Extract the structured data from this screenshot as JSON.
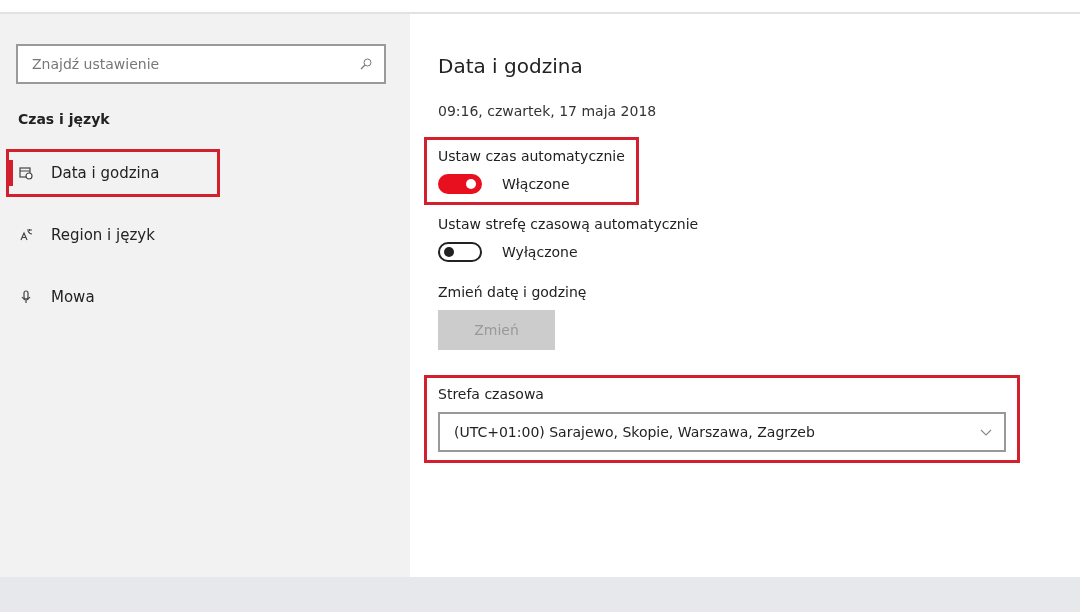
{
  "sidebar": {
    "search": {
      "placeholder": "Znajdź ustawienie"
    },
    "section_title": "Czas i język",
    "items": [
      {
        "label": "Data i godzina",
        "selected": true,
        "highlighted": true
      },
      {
        "label": "Region i język",
        "selected": false,
        "highlighted": false
      },
      {
        "label": "Mowa",
        "selected": false,
        "highlighted": false
      }
    ]
  },
  "content": {
    "heading": "Data i godzina",
    "current_time": "09:16, czwartek, 17 maja 2018",
    "settings": [
      {
        "kind": "toggle",
        "label": "Ustaw czas automatycznie",
        "on": true,
        "state_text": "Włączone",
        "highlighted": true
      },
      {
        "kind": "toggle",
        "label": "Ustaw strefę czasową automatycznie",
        "on": false,
        "state_text": "Wyłączone",
        "highlighted": false
      },
      {
        "kind": "button",
        "label": "Zmień datę i godzinę",
        "button": "Zmień",
        "disabled": true,
        "highlighted": false
      },
      {
        "kind": "dropdown",
        "label": "Strefa czasowa",
        "value": "(UTC+01:00) Sarajewo, Skopie, Warszawa, Zagrzeb",
        "highlighted": true
      }
    ]
  }
}
